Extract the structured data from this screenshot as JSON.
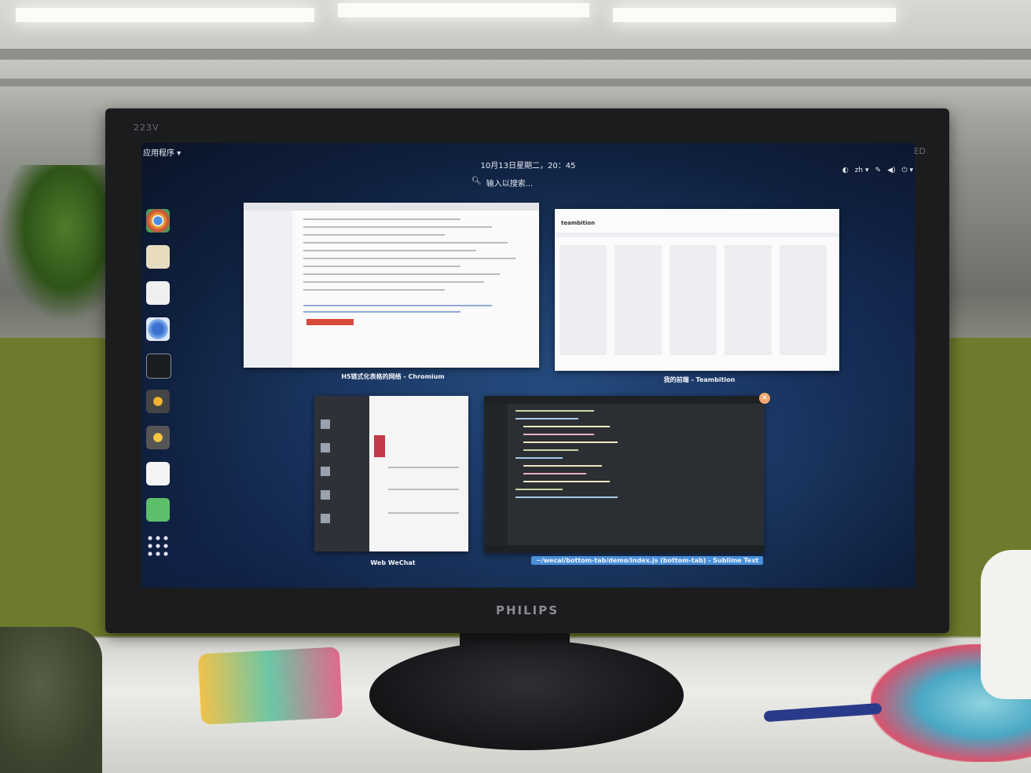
{
  "monitor": {
    "model": "223V",
    "led_label": "LED",
    "brand": "PHILIPS"
  },
  "topbar": {
    "apps_menu": "应用程序 ▾",
    "clock": "10月13日星期二，20：45",
    "input_method": "zh ▾"
  },
  "search": {
    "icon": "search-icon",
    "placeholder": "输入以搜索..."
  },
  "dash": {
    "icons": [
      "chrome-icon",
      "mail-icon",
      "files-icon",
      "chromium-icon",
      "terminal-icon",
      "sublime-text-icon",
      "sublime-text-icon",
      "text-editor-icon",
      "other-app-icon",
      "app-grid-icon"
    ]
  },
  "windows": [
    {
      "label": "H5链式化表格的网络 - Chromium"
    },
    {
      "label": "我的前端 - Teambition"
    },
    {
      "label": "Web WeChat"
    },
    {
      "label": "~/wecal/bottom-tab/demo/index.js (bottom-tab) - Sublime Text"
    }
  ],
  "teambition": {
    "logo": "teambition"
  }
}
